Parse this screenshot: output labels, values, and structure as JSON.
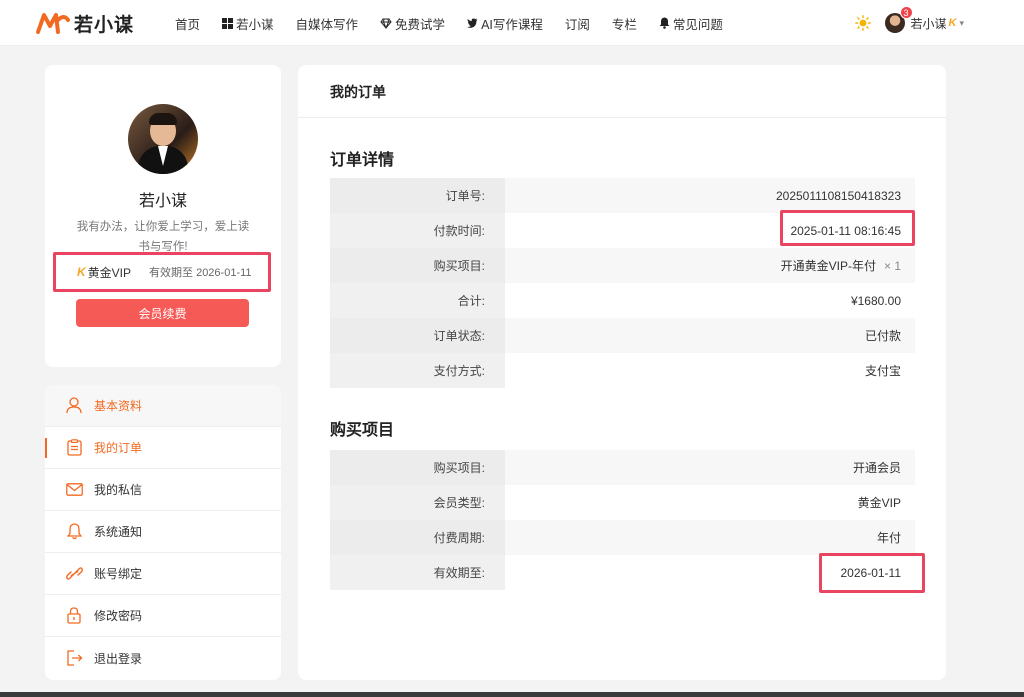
{
  "header": {
    "logo_text": "若小谋",
    "nav": [
      {
        "label": "首页",
        "icon": ""
      },
      {
        "label": "若小谋",
        "icon": "windows-icon"
      },
      {
        "label": "自媒体写作",
        "icon": ""
      },
      {
        "label": "免费试学",
        "icon": "diamond-icon"
      },
      {
        "label": "AI写作课程",
        "icon": "twitter-bird-icon"
      },
      {
        "label": "订阅",
        "icon": ""
      },
      {
        "label": "专栏",
        "icon": ""
      },
      {
        "label": "常见问题",
        "icon": "bell-icon"
      }
    ],
    "notification_count": "3",
    "user_name": "若小谋",
    "vip_mark": "K"
  },
  "profile": {
    "name": "若小谋",
    "bio": "我有办法，让你爱上学习，爱上读书与写作!",
    "vip_mark": "K",
    "vip_level": "黄金VIP",
    "expiry": "有效期至 2026-01-11",
    "renew_label": "会员续费"
  },
  "menu": [
    {
      "label": "基本资料",
      "icon": "user-icon"
    },
    {
      "label": "我的订单",
      "icon": "order-icon"
    },
    {
      "label": "我的私信",
      "icon": "mail-icon"
    },
    {
      "label": "系统通知",
      "icon": "bell-icon"
    },
    {
      "label": "账号绑定",
      "icon": "link-icon"
    },
    {
      "label": "修改密码",
      "icon": "lock-icon"
    },
    {
      "label": "退出登录",
      "icon": "logout-icon"
    }
  ],
  "main": {
    "title": "我的订单",
    "order_section_title": "订单详情",
    "order_rows": [
      {
        "label": "订单号:",
        "value": "20250111081504183​23"
      },
      {
        "label": "付款时间:",
        "value": "2025-01-11 08:16:45"
      },
      {
        "label": "购买项目:",
        "value": "开通黄金VIP-年付",
        "qty": "× 1"
      },
      {
        "label": "合计:",
        "value": "¥1680.00"
      },
      {
        "label": "订单状态:",
        "value": "已付款"
      },
      {
        "label": "支付方式:",
        "value": "支付宝"
      }
    ],
    "item_section_title": "购买项目",
    "item_rows": [
      {
        "label": "购买项目:",
        "value": "开通会员"
      },
      {
        "label": "会员类型:",
        "value": "黄金VIP"
      },
      {
        "label": "付费周期:",
        "value": "年付"
      },
      {
        "label": "有效期至:",
        "value": "2026-01-11"
      }
    ]
  },
  "colors": {
    "accent": "#f26a22",
    "highlight": "#e94560",
    "button": "#f55a56"
  }
}
